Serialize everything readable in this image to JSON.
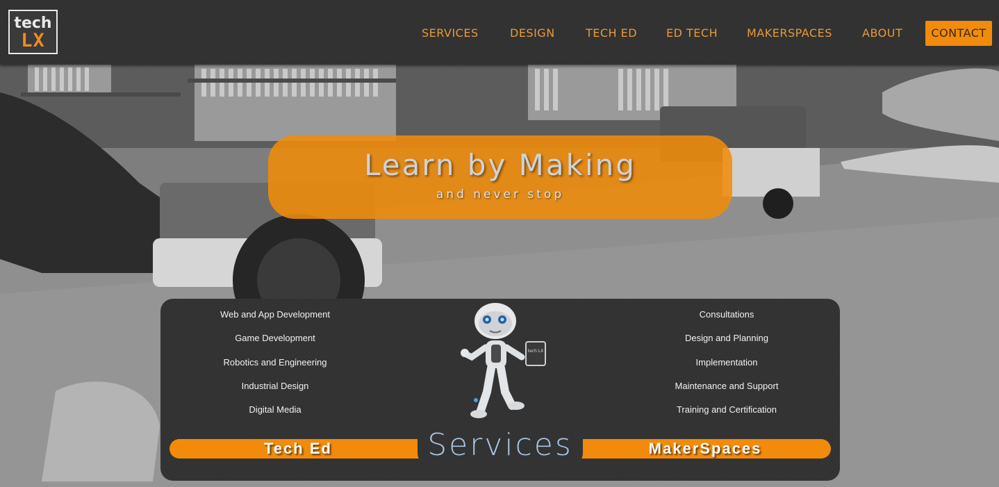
{
  "logo": {
    "line1": "tech",
    "line2": "LX"
  },
  "nav": {
    "items": [
      "SERVICES",
      "DESIGN",
      "TECH ED",
      "ED TECH",
      "MAKERSPACES",
      "ABOUT"
    ],
    "contact": "CONTACT"
  },
  "hero": {
    "title": "Learn by Making",
    "subtitle": "and never stop"
  },
  "services": {
    "left": [
      "Web and App Development",
      "Game Development",
      "Robotics and Engineering",
      "Industrial Design",
      "Digital Media"
    ],
    "right": [
      "Consultations",
      "Design and Planning",
      "Implementation",
      "Maintenance and Support",
      "Training and Certification"
    ],
    "left_bar": "Tech Ed",
    "center_title": "Services",
    "right_bar": "MakerSpaces",
    "mascot_tablet_text": "tech LX"
  },
  "colors": {
    "accent": "#f28b0c",
    "nav_text": "#e89a3a",
    "header_bg": "#333333",
    "services_title": "#a9c7e6"
  }
}
